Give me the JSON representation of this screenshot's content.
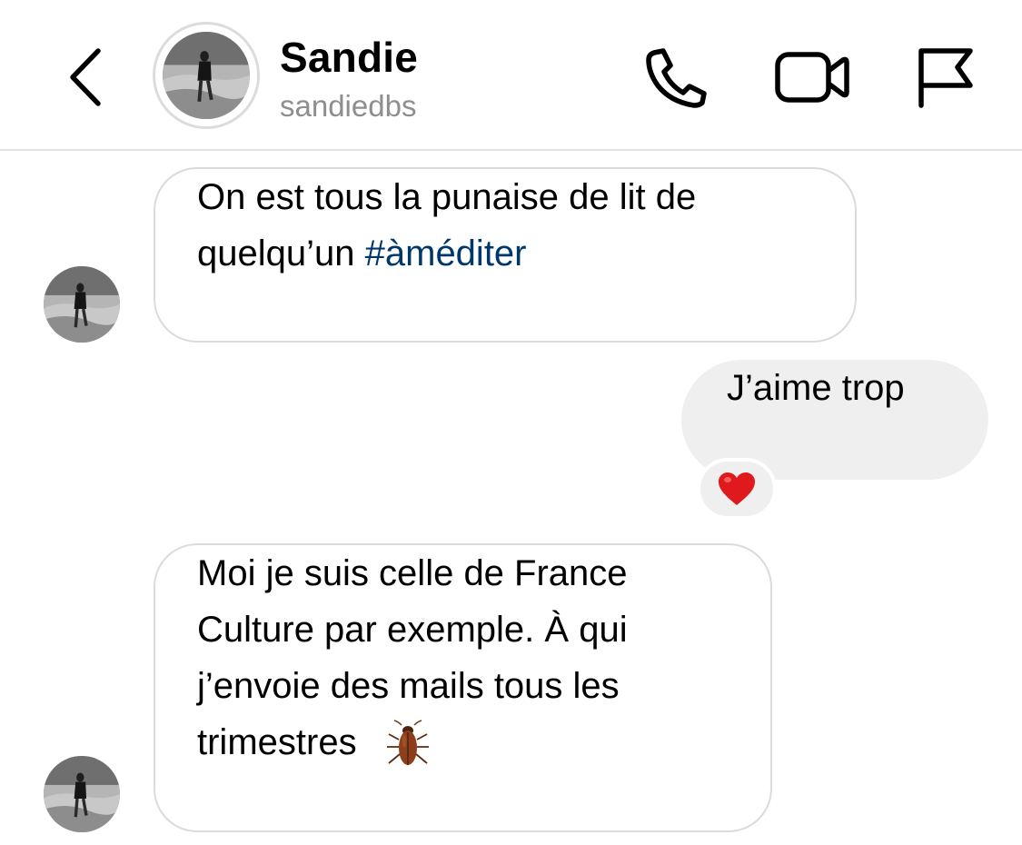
{
  "header": {
    "contact_name": "Sandie",
    "contact_handle": "sandiedbs",
    "icons": [
      "back-chevron-icon",
      "phone-icon",
      "video-camera-icon",
      "flag-icon"
    ]
  },
  "messages": [
    {
      "direction": "incoming",
      "line1": "On est tous la punaise de lit de",
      "line2_text": "quelqu’un",
      "line2_hashtag": "#àméditer"
    },
    {
      "direction": "outgoing",
      "text": "J’aime trop",
      "reaction": "❤️"
    },
    {
      "direction": "incoming",
      "line1": "Moi je suis celle de France",
      "line2": "Culture par exemple. À qui",
      "line3": "j’envoie des mails tous les",
      "line4": "trimestres",
      "emoji": "cockroach-emoji"
    }
  ],
  "colors": {
    "hashtag": "#00376b",
    "outgoing_bubble": "#efefef",
    "incoming_border": "#dbdbdb",
    "handle_gray": "#8e8e8e",
    "heart": "#e0191d"
  }
}
